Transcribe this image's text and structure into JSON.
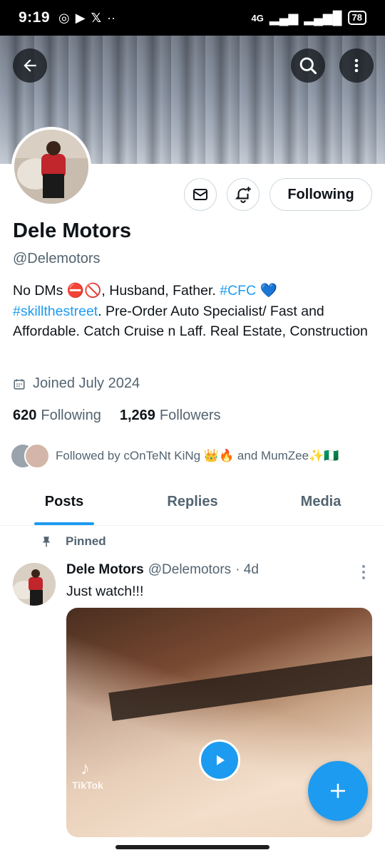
{
  "status_bar": {
    "time": "9:19",
    "network": "4G",
    "battery": "78"
  },
  "profile": {
    "display_name": "Dele Motors",
    "handle": "@Delemotors",
    "follow_button": "Following",
    "bio_text_1": "No DMs ⛔🚫, Husband, Father. ",
    "bio_link_1": "#CFC",
    "bio_text_2": " 💙 ",
    "bio_link_2": "#skillthestreet",
    "bio_text_3": ". Pre-Order Auto Specialist/ Fast and Affordable. Catch Cruise n Laff. Real Estate, Construction",
    "joined": "Joined July 2024",
    "following_count": "620",
    "following_label": "Following",
    "followers_count": "1,269",
    "followers_label": "Followers",
    "followed_by": "Followed by cOnTeNt KiNg 👑🔥 and MumZee✨🇳🇬"
  },
  "tabs": [
    {
      "label": "Posts",
      "active": true
    },
    {
      "label": "Replies",
      "active": false
    },
    {
      "label": "Media",
      "active": false
    }
  ],
  "pinned_post": {
    "pinned_label": "Pinned",
    "author": "Dele Motors",
    "handle": "@Delemotors",
    "time": "· 4d",
    "text": "Just watch!!!",
    "watermark": "TikTok"
  },
  "colors": {
    "accent": "#1d9bf0",
    "text_primary": "#0f1419",
    "text_secondary": "#536471"
  },
  "icons": [
    "back-arrow-icon",
    "search-icon",
    "more-vertical-icon",
    "mail-icon",
    "bell-plus-icon",
    "calendar-icon",
    "pin-icon",
    "play-icon",
    "compose-plus-icon"
  ]
}
